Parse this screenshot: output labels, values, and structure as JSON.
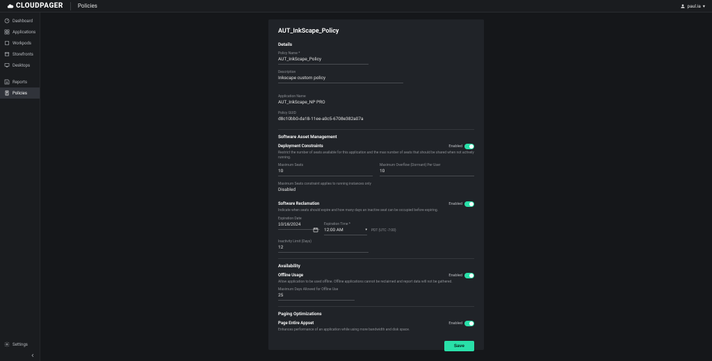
{
  "brand": "CLOUDPAGER",
  "top_section": "Policies",
  "user": {
    "name": "paul.ia",
    "chevron": "▾"
  },
  "sidebar": {
    "items": [
      {
        "icon": "dashboard-icon",
        "label": "Dashboard"
      },
      {
        "icon": "applications-icon",
        "label": "Applications"
      },
      {
        "icon": "workpods-icon",
        "label": "Workpods"
      },
      {
        "icon": "storefronts-icon",
        "label": "Storefronts"
      },
      {
        "icon": "desktops-icon",
        "label": "Desktops"
      },
      {
        "icon": "reports-icon",
        "label": "Reports"
      },
      {
        "icon": "policies-icon",
        "label": "Policies"
      }
    ],
    "settings": "Settings"
  },
  "policy": {
    "title": "AUT_InkScape_Policy",
    "details_label": "Details",
    "name_label": "Policy Name *",
    "name_value": "AUT_InkScape_Policy",
    "desc_label": "Description",
    "desc_value": "Inkscape custom policy",
    "app_name_label": "Application Name",
    "app_name_value": "AUT_InkScape_NP PRO",
    "guid_label": "Policy GUID",
    "guid_value": "d8c10bb0-da18-11ee-a0c5-6708e382a07a",
    "sam_label": "Software Asset Management",
    "deploy": {
      "heading": "Deployment Constraints",
      "desc": "Restrict the number of seats available for this application and the max number of seats that should be shared when not actively running.",
      "max_seats_label": "Maximum Seats",
      "max_seats_value": "10",
      "max_overflow_label": "Maximum Overflow (Dormant) Per User",
      "max_overflow_value": "10",
      "note_label": "Maximum Seats constraint applies to running instances only",
      "note_value": "Disabled",
      "toggle_label": "Enabled"
    },
    "reclaim": {
      "heading": "Software Reclamation",
      "desc": "Indicate when seats should expire and how many days an inactive seat can be occupied before expiring.",
      "exp_date_label": "Expiration Date",
      "exp_date_value": "10/16/2024",
      "exp_time_label": "Expiration Time *",
      "exp_time_value": "12:00 AM",
      "tz": "PDT (UTC -7:00)",
      "inactivity_label": "Inactivity Limit (Days)",
      "inactivity_value": "12",
      "toggle_label": "Enabled"
    },
    "availability_label": "Availability",
    "offline": {
      "heading": "Offline Usage",
      "desc": "Allow application to be used offline. Offline applications cannot be reclaimed and report data will not be gathered.",
      "max_offline_label": "Maximum Days Allowed for Offline Use",
      "max_offline_value": "25",
      "toggle_label": "Enabled"
    },
    "paging_label": "Paging Optimizations",
    "appset": {
      "heading": "Page Entire Appset",
      "desc": "Enhances performance of an application while using more bandwidth and disk space.",
      "toggle_label": "Enabled"
    },
    "save_label": "Save"
  }
}
